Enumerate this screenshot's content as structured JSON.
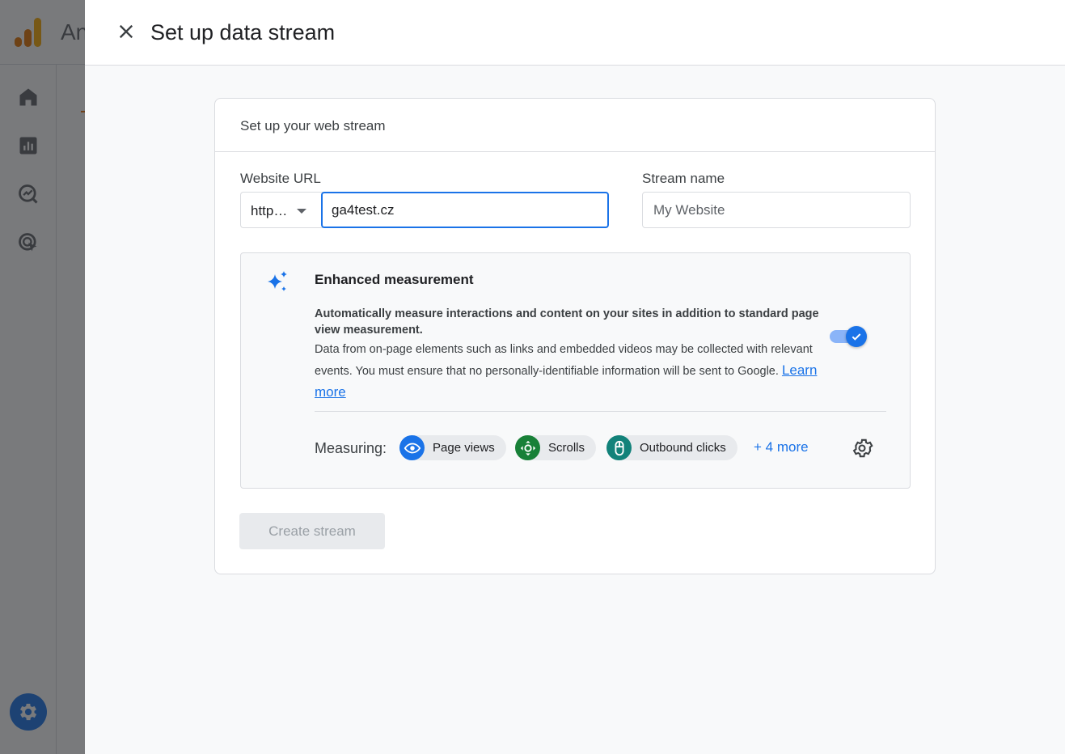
{
  "background_app": {
    "title_fragment": "An",
    "rail_items": [
      "home-icon",
      "reports-icon",
      "explore-icon",
      "advertising-icon"
    ],
    "settings_icon": "gear-icon"
  },
  "dialog": {
    "title": "Set up data stream",
    "close_icon": "close-icon"
  },
  "card": {
    "title": "Set up your web stream",
    "website_url": {
      "label": "Website URL",
      "protocol_value": "http…",
      "value": "ga4test.cz"
    },
    "stream_name": {
      "label": "Stream name",
      "placeholder": "My Website",
      "value": ""
    },
    "enhanced_measurement": {
      "title": "Enhanced measurement",
      "bold_text": "Automatically measure interactions and content on your sites in addition to standard page view measurement.",
      "description": "Data from on-page elements such as links and embedded videos may be collected with relevant events. You must ensure that no personally-identifiable information will be sent to Google.",
      "learn_more": "Learn more",
      "enabled": true,
      "measuring_label": "Measuring:",
      "chips": [
        {
          "label": "Page views",
          "icon": "eye-icon",
          "color": "#1a73e8"
        },
        {
          "label": "Scrolls",
          "icon": "scroll-icon",
          "color": "#188038"
        },
        {
          "label": "Outbound clicks",
          "icon": "mouse-icon",
          "color": "#12827a"
        }
      ],
      "more_link": "+ 4 more"
    },
    "create_button": "Create stream"
  },
  "colors": {
    "accent": "#1a73e8",
    "scrim": "rgba(32,33,36,0.6)"
  }
}
